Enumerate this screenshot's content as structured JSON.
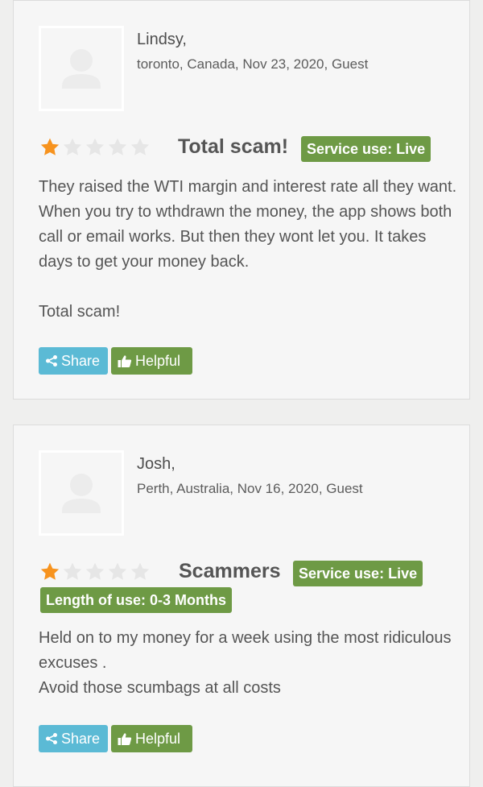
{
  "reviews": [
    {
      "author": "Lindsy,",
      "meta": "toronto, Canada, Nov 23, 2020, Guest",
      "rating": 1,
      "rating_max": 5,
      "title": "Total scam!",
      "service_badge": "Service use: Live",
      "paragraphs": [
        "They raised the WTI margin and interest rate all they want. When you try to wthdrawn the money, the app shows both call or email works. But then they wont let you. It takes days to get your money back.",
        "Total scam!"
      ],
      "share_label": "Share",
      "helpful_label": "Helpful"
    },
    {
      "author": "Josh,",
      "meta": "Perth, Australia, Nov 16, 2020, Guest",
      "rating": 1,
      "rating_max": 5,
      "title": "Scammers",
      "service_badge": "Service use: Live",
      "length_badge": "Length of use: 0-3 Months",
      "paragraphs": [
        "Held on to my money for a week using the most ridiculous excuses .",
        "Avoid those scumbags at all costs"
      ],
      "share_label": "Share",
      "helpful_label": "Helpful"
    }
  ],
  "colors": {
    "star_filled": "#f7931e",
    "star_empty": "#e6e6e6",
    "badge": "#6e9a45",
    "share": "#5bbad5"
  }
}
